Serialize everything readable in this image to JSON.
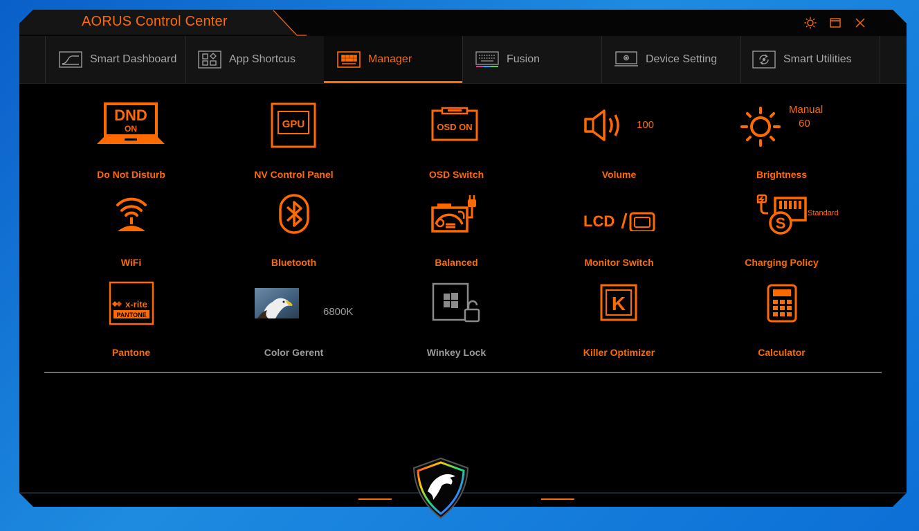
{
  "window": {
    "title": "AORUS Control Center",
    "controls": [
      "sun-icon",
      "restore-icon",
      "close-icon"
    ]
  },
  "tabs": [
    {
      "label": "Smart Dashboard",
      "icon": "dashboard-icon",
      "active": false
    },
    {
      "label": "App Shortcus",
      "icon": "app-grid-icon",
      "active": false
    },
    {
      "label": "Manager",
      "icon": "keyboard-panel-icon",
      "active": true
    },
    {
      "label": "Fusion",
      "icon": "keyboard-rgb-icon",
      "active": false
    },
    {
      "label": "Device Setting",
      "icon": "monitor-gear-icon",
      "active": false
    },
    {
      "label": "Smart Utilities",
      "icon": "utility-icon",
      "active": false
    }
  ],
  "manager": {
    "row1": [
      {
        "label": "Do Not Disturb",
        "icon": "dnd-laptop-icon",
        "icon_text_top": "DND",
        "icon_text_bottom": "ON"
      },
      {
        "label": "NV Control Panel",
        "icon": "gpu-icon",
        "icon_text": "GPU"
      },
      {
        "label": "OSD Switch",
        "icon": "osd-icon",
        "icon_text": "OSD ON"
      },
      {
        "label": "Volume",
        "icon": "speaker-icon",
        "value": "100"
      },
      {
        "label": "Brightness",
        "icon": "sun-icon",
        "mode": "Manual",
        "value": "60"
      }
    ],
    "row2": [
      {
        "label": "WiFi",
        "icon": "wifi-icon"
      },
      {
        "label": "Bluetooth",
        "icon": "bluetooth-icon"
      },
      {
        "label": "Balanced",
        "icon": "power-mode-icon"
      },
      {
        "label": "Monitor Switch",
        "icon": "lcd-monitor-icon",
        "icon_text": "LCD"
      },
      {
        "label": "Charging Policy",
        "icon": "charging-icon",
        "value": "Standard",
        "icon_text": "S"
      }
    ],
    "row3": [
      {
        "label": "Pantone",
        "icon": "xrite-pantone-icon",
        "icon_text_top": "x-rite",
        "icon_text_bottom": "PANTONE"
      },
      {
        "label": "Color Gerent",
        "icon": "eagle-thumbnail-icon",
        "value": "6800K"
      },
      {
        "label": "Winkey Lock",
        "icon": "winkey-lock-icon"
      },
      {
        "label": "Killer Optimizer",
        "icon": "killer-icon",
        "icon_text": "K"
      },
      {
        "label": "Calculator",
        "icon": "calculator-icon"
      }
    ]
  },
  "colors": {
    "accent": "#ff6a00",
    "background": "#000000",
    "tabbar": "#141414",
    "inactive_text": "#a6a6a6",
    "disabled_label": "#9c9c9c"
  },
  "logo": "aorus-eagle-logo"
}
